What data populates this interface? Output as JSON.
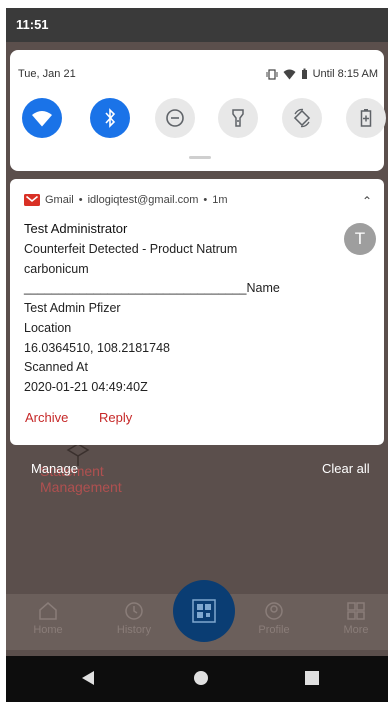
{
  "status_bar": {
    "time": "11:51"
  },
  "quick_settings": {
    "date": "Tue, Jan 21",
    "alarm": "Until 8:15 AM",
    "tiles": [
      {
        "name": "wifi",
        "state": "on"
      },
      {
        "name": "bluetooth",
        "state": "on"
      },
      {
        "name": "do-not-disturb",
        "state": "off"
      },
      {
        "name": "flashlight",
        "state": "off"
      },
      {
        "name": "auto-rotate",
        "state": "off"
      },
      {
        "name": "battery-saver",
        "state": "off"
      }
    ]
  },
  "notification": {
    "app": "Gmail",
    "account": "idlogiqtest@gmail.com",
    "time": "1m",
    "sender": "Test Administrator",
    "avatar_letter": "T",
    "body": "Counterfeit Detected - Product Natrum\ncarbonicum\n________________________________Name\nTest Admin Pfizer\nLocation\n16.0364510, 108.2181748\nScanned At\n2020-01-21 04:49:40Z",
    "actions": {
      "archive": "Archive",
      "reply": "Reply"
    }
  },
  "shade": {
    "manage": "Manage",
    "clear_all": "Clear all"
  },
  "background_app": {
    "menu_label": "Statement\nManagement",
    "nav": {
      "home": "Home",
      "history": "History",
      "profile": "Profile",
      "more": "More"
    }
  }
}
